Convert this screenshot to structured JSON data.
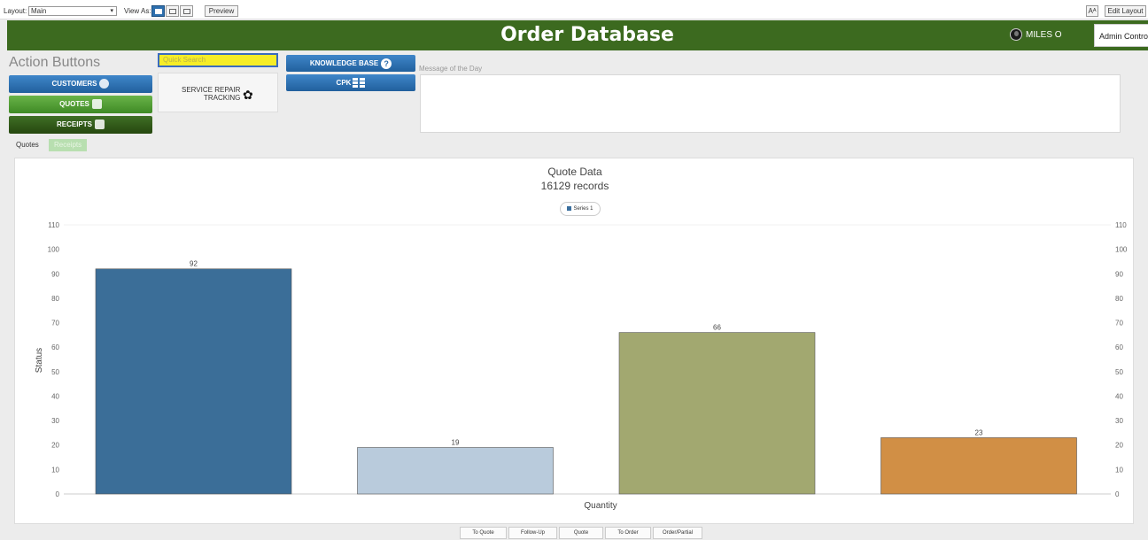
{
  "layout_bar": {
    "layout_label": "Layout:",
    "layout_value": "Main",
    "view_as_label": "View As:",
    "preview_label": "Preview",
    "aa_label": "Aᴬ",
    "edit_layout_label": "Edit Layout"
  },
  "header": {
    "title": "Order Database",
    "user_name": "MILES O",
    "admin_label": "Admin Control",
    "color": "#3c6a1f"
  },
  "actions": {
    "title": "Action Buttons",
    "customers_label": "CUSTOMERS",
    "quotes_label": "QUOTES",
    "receipts_label": "RECEIPTS",
    "quick_search_placeholder": "Quick Search",
    "service_line1": "SERVICE REPAIR",
    "service_line2": "TRACKING",
    "knowledge_base_label": "KNOWLEDGE BASE",
    "cpk_label": "CPK",
    "motd_label": "Message of the Day"
  },
  "tabs": [
    {
      "label": "Quotes",
      "active": true
    },
    {
      "label": "Receipts",
      "active": false
    }
  ],
  "chart_data": {
    "type": "bar",
    "title": "Quote Data",
    "subtitle": "16129 records",
    "xlabel": "Quantity",
    "ylabel": "Status",
    "ylim": [
      0,
      110
    ],
    "yticks": [
      0,
      10,
      20,
      30,
      40,
      50,
      60,
      70,
      80,
      90,
      100,
      110
    ],
    "legend": [
      "Series 1"
    ],
    "legend_position": "top-center",
    "grid": false,
    "series": [
      {
        "name": "Series 1",
        "values": [
          92,
          19,
          66,
          23
        ],
        "colors": [
          "#3b6e98",
          "#b9cbdc",
          "#a2a870",
          "#d18f45"
        ]
      }
    ],
    "data_labels": [
      "92",
      "19",
      "66",
      "23"
    ]
  },
  "bottom_buttons": [
    "To Quote",
    "Follow-Up",
    "Quote",
    "To Order",
    "Order/Partial"
  ]
}
